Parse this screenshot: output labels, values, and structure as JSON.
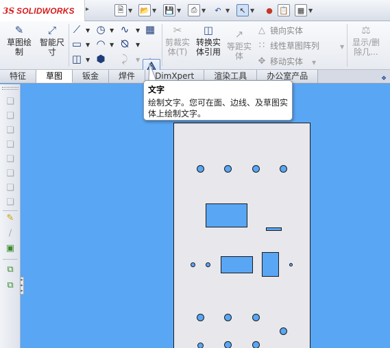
{
  "app": {
    "brand_mark": "3S",
    "brand_name": "SOLIDWORKS"
  },
  "quick_access": [
    {
      "icon": "new-document-icon"
    },
    {
      "icon": "open-folder-icon"
    },
    {
      "icon": "save-icon"
    },
    {
      "icon": "print-icon"
    },
    {
      "icon": "undo-icon"
    },
    {
      "icon": "select-arrow-icon"
    },
    {
      "icon": "rebuild-traffic-light-icon"
    },
    {
      "icon": "file-properties-icon"
    },
    {
      "icon": "options-icon"
    }
  ],
  "command_manager": {
    "sketch": "草图绘\n制",
    "smart_dimension": "智能尺\n寸",
    "trim": "剪裁实\n体(T)",
    "convert": "转换实\n体引用",
    "offset": "等距实\n体",
    "mirror": "镜向实体",
    "linear_pattern": "线性草图阵列",
    "move": "移动实体",
    "display_delete": "显示/删\n除几..."
  },
  "tabs": [
    "特征",
    "草图",
    "钣金",
    "焊件",
    "DimXpert",
    "渲染工具",
    "办公室产品"
  ],
  "active_tab": "草图",
  "tooltip": {
    "title": "文字",
    "body": "绘制文字。您可在面、边线、及草图实体上绘制文字。"
  },
  "colors": {
    "canvas": "#59a6f5",
    "part_face": "#e8e8ec",
    "brand_red": "#d61a1a",
    "active_button": "#cfe0f7"
  }
}
